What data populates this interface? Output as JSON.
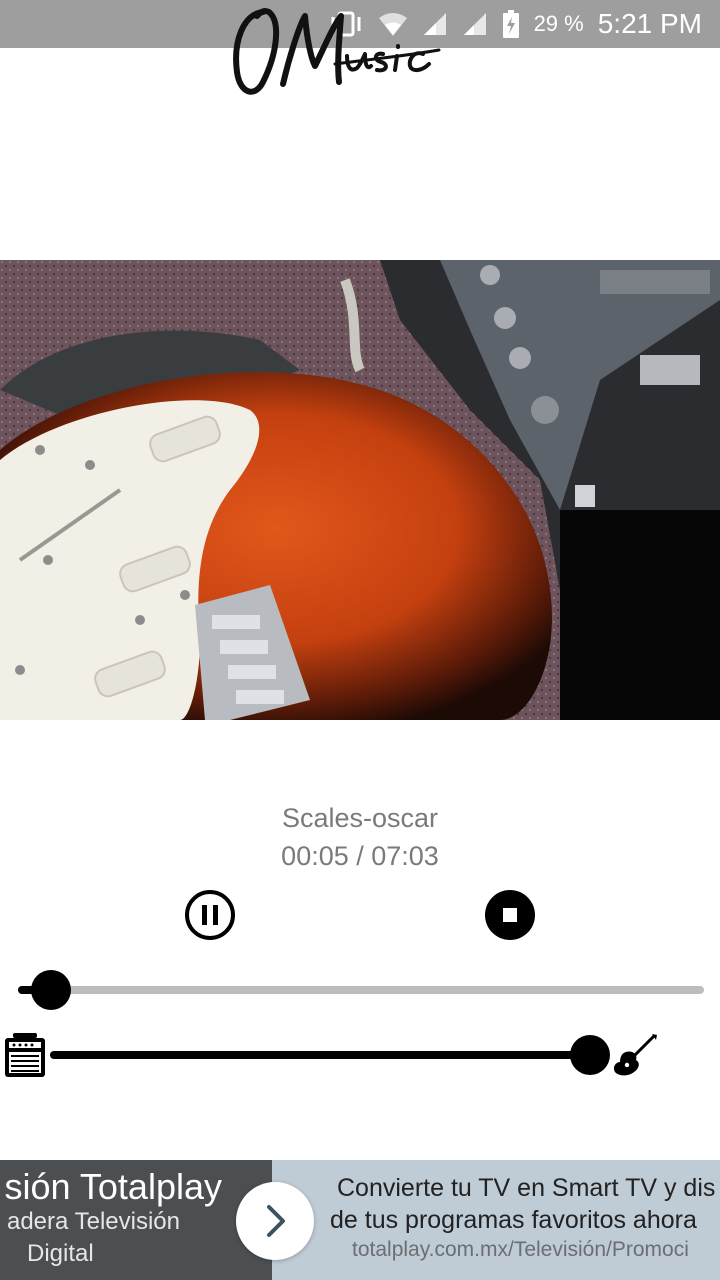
{
  "status_bar": {
    "battery_percent": "29 %",
    "time": "5:21 PM",
    "icons": [
      "vibrate-icon",
      "wifi-icon",
      "signal-icon",
      "signal-icon",
      "battery-charging-icon"
    ]
  },
  "app": {
    "logo_text": "OMusic"
  },
  "player": {
    "track_title": "Scales-oscar",
    "time_display": "00:05 / 07:03",
    "progress_fraction": 0.04,
    "mix_fraction": 1.0,
    "pause_icon": "pause-icon",
    "stop_icon": "stop-icon",
    "mix_left_icon": "amplifier-icon",
    "mix_right_icon": "guitar-icon"
  },
  "ad": {
    "brand": "sión Totalplay",
    "subtitle_1": "adera Televisión",
    "subtitle_2": "Digital",
    "headline_1": "Convierte tu TV en Smart TV y dis",
    "headline_2": "de tus programas favoritos ahora",
    "url": "totalplay.com.mx/Televisión/Promoci",
    "arrow_icon": "chevron-right-icon"
  },
  "colors": {
    "status_bar": "#9e9e9e",
    "text_muted": "#7a7a7a",
    "slider_track": "#bdbdbd",
    "slider_active": "#000000",
    "ad_dark": "#4b4f52",
    "ad_light": "#bfcbd5"
  }
}
